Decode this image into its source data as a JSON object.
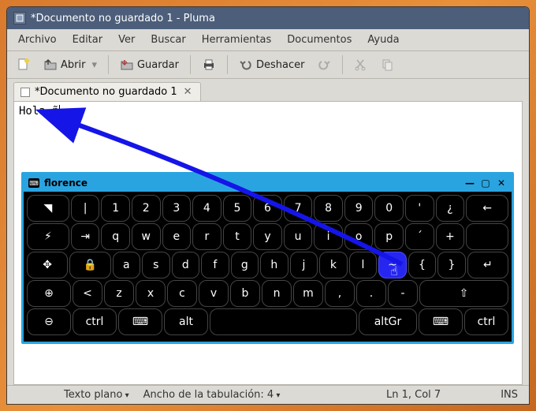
{
  "window": {
    "title": "*Documento no guardado 1 - Pluma"
  },
  "menu": {
    "archivo": "Archivo",
    "editar": "Editar",
    "ver": "Ver",
    "buscar": "Buscar",
    "herramientas": "Herramientas",
    "documentos": "Documentos",
    "ayuda": "Ayuda"
  },
  "toolbar": {
    "abrir": "Abrir",
    "guardar": "Guardar",
    "deshacer": "Deshacer"
  },
  "tab": {
    "label": "*Documento no guardado 1"
  },
  "editor": {
    "content": "Hola ñ"
  },
  "status": {
    "syntax": "Texto plano",
    "tabwidth_label": "Ancho de la tabulación:",
    "tabwidth_value": "4",
    "position": "Ln 1, Col 7",
    "insert": "INS"
  },
  "florence": {
    "title": "florence",
    "highlighted_key": "~",
    "keys": {
      "ctrl": "ctrl",
      "alt": "alt",
      "altgr": "altGr"
    }
  }
}
